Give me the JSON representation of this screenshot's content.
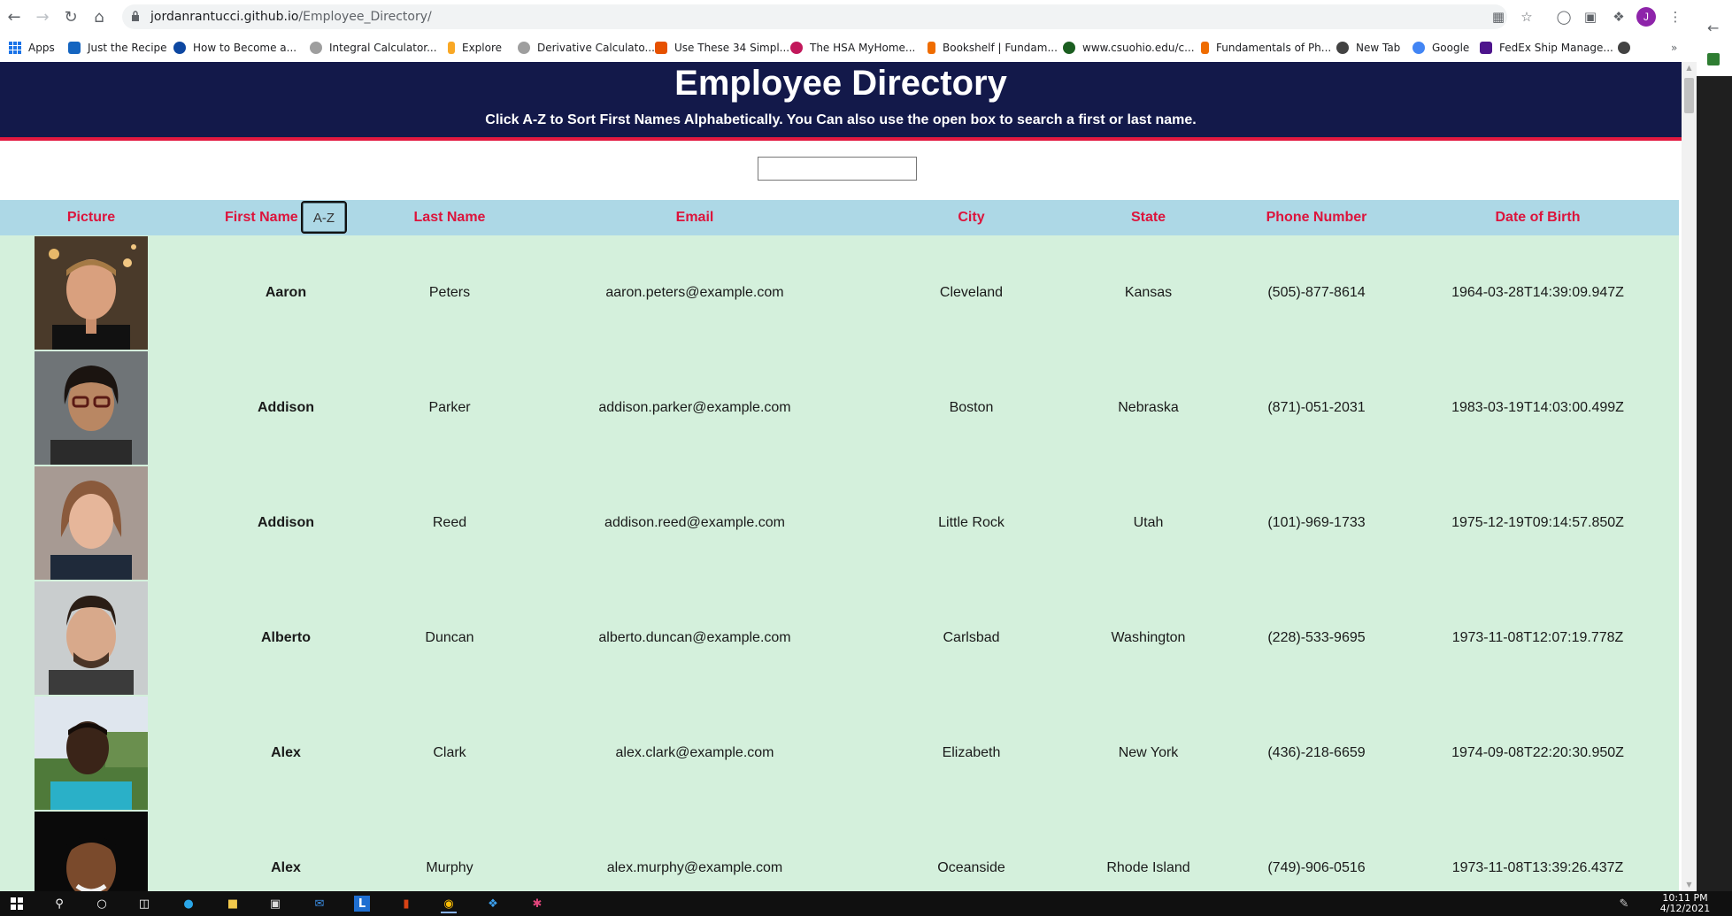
{
  "browser": {
    "url_domain": "jordanrantucci.github.io",
    "url_path": "/Employee_Directory/",
    "profile_initial": "J",
    "bookmarks": [
      {
        "label": "Apps",
        "icon": "apps-grid-icon",
        "color": "#1a73e8"
      },
      {
        "label": "Just the Recipe",
        "icon": "recipe-icon",
        "color": "#1565c0"
      },
      {
        "label": "How to Become a...",
        "icon": "globe-icon",
        "color": "#0d47a1"
      },
      {
        "label": "Integral Calculator...",
        "icon": "gear-icon",
        "color": "#757575"
      },
      {
        "label": "Explore",
        "icon": "explore-icon",
        "color": "#f9a825"
      },
      {
        "label": "Derivative Calculato...",
        "icon": "gear-icon",
        "color": "#757575"
      },
      {
        "label": "Use These 34 Simpl...",
        "icon": "article-icon",
        "color": "#e65100"
      },
      {
        "label": "The HSA MyHome...",
        "icon": "hsa-icon",
        "color": "#c2185b"
      },
      {
        "label": "Bookshelf | Fundam...",
        "icon": "bookshelf-icon",
        "color": "#ef6c00"
      },
      {
        "label": "www.csuohio.edu/c...",
        "icon": "csu-icon",
        "color": "#1b5e20"
      },
      {
        "label": "Fundamentals of Ph...",
        "icon": "bookshelf-icon",
        "color": "#ef6c00"
      },
      {
        "label": "New Tab",
        "icon": "chrome-icon",
        "color": "#424242"
      },
      {
        "label": "Google",
        "icon": "google-icon",
        "color": "#4285f4"
      },
      {
        "label": "FedEx Ship Manage...",
        "icon": "fedex-icon",
        "color": "#4d148c"
      }
    ]
  },
  "header": {
    "title": "Employee Directory",
    "subtitle": "Click A-Z to Sort First Names Alphabetically. You Can also use the open box to search a first or last name.",
    "bg_color": "#13194a",
    "accent_color": "#e3193f"
  },
  "search": {
    "placeholder": "",
    "value": ""
  },
  "table": {
    "sort_button_label": "A-Z",
    "columns": [
      "Picture",
      "First Name",
      "Last Name",
      "Email",
      "City",
      "State",
      "Phone Number",
      "Date of Birth"
    ],
    "header_color": "#add8e6",
    "header_text_color": "#dc143c",
    "row_color": "#d4f0dc",
    "rows": [
      {
        "first": "Aaron",
        "last": "Peters",
        "email": "aaron.peters@example.com",
        "city": "Cleveland",
        "state": "Kansas",
        "phone": "(505)-877-8614",
        "dob": "1964-03-28T14:39:09.947Z"
      },
      {
        "first": "Addison",
        "last": "Parker",
        "email": "addison.parker@example.com",
        "city": "Boston",
        "state": "Nebraska",
        "phone": "(871)-051-2031",
        "dob": "1983-03-19T14:03:00.499Z"
      },
      {
        "first": "Addison",
        "last": "Reed",
        "email": "addison.reed@example.com",
        "city": "Little Rock",
        "state": "Utah",
        "phone": "(101)-969-1733",
        "dob": "1975-12-19T09:14:57.850Z"
      },
      {
        "first": "Alberto",
        "last": "Duncan",
        "email": "alberto.duncan@example.com",
        "city": "Carlsbad",
        "state": "Washington",
        "phone": "(228)-533-9695",
        "dob": "1973-11-08T12:07:19.778Z"
      },
      {
        "first": "Alex",
        "last": "Clark",
        "email": "alex.clark@example.com",
        "city": "Elizabeth",
        "state": "New York",
        "phone": "(436)-218-6659",
        "dob": "1974-09-08T22:20:30.950Z"
      },
      {
        "first": "Alex",
        "last": "Murphy",
        "email": "alex.murphy@example.com",
        "city": "Oceanside",
        "state": "Rhode Island",
        "phone": "(749)-906-0516",
        "dob": "1973-11-08T13:39:26.437Z"
      }
    ]
  },
  "taskbar": {
    "time": "10:11 PM",
    "date": "4/12/2021"
  }
}
